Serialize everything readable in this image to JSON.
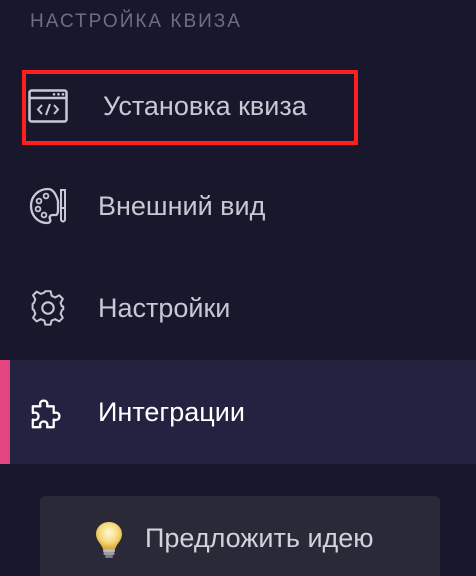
{
  "sidebar": {
    "section_title": "НАСТРОЙКА КВИЗА",
    "items": [
      {
        "label": "Установка квиза",
        "icon": "code-window-icon"
      },
      {
        "label": "Внешний вид",
        "icon": "palette-icon"
      },
      {
        "label": "Настройки",
        "icon": "gear-icon"
      },
      {
        "label": "Интеграции",
        "icon": "puzzle-icon",
        "active": true
      }
    ],
    "suggest_label": "Предложить идею",
    "suggest_icon": "lightbulb-icon"
  },
  "colors": {
    "background": "#18172b",
    "active_background": "#232241",
    "active_accent": "#e2457f",
    "highlight": "#ff1f1f"
  }
}
